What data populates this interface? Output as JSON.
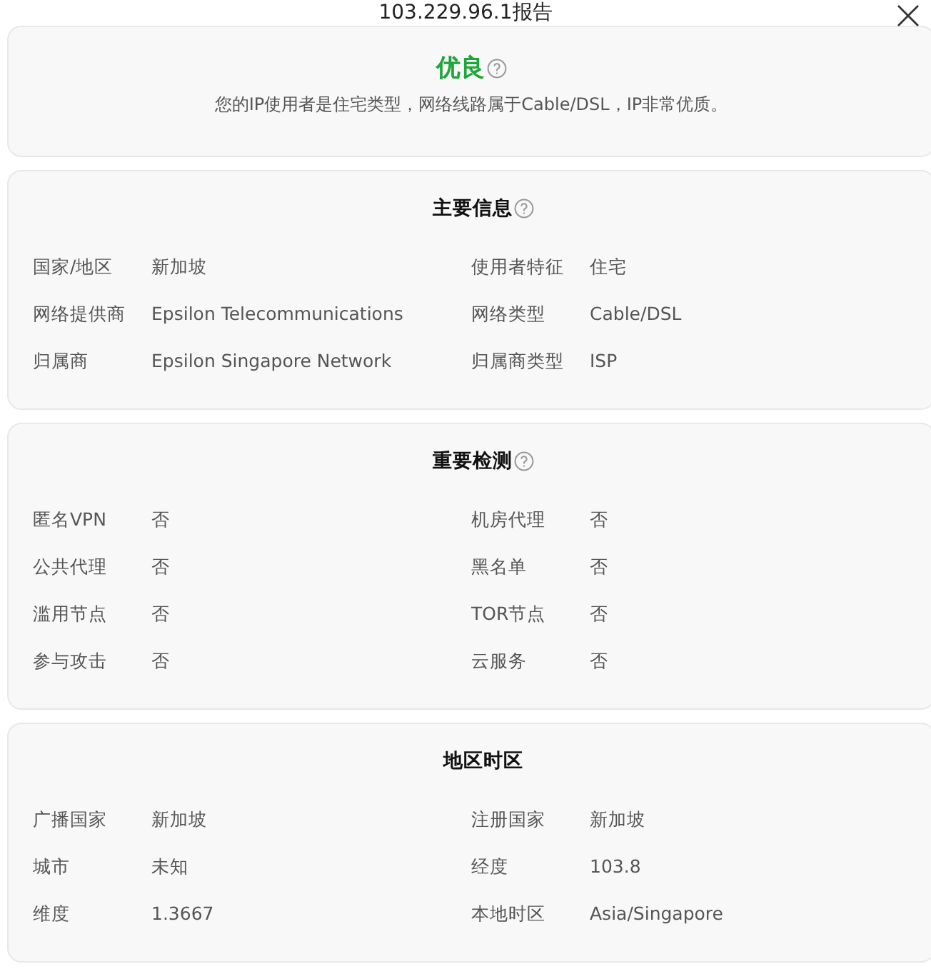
{
  "dialog": {
    "title": "103.229.96.1报告"
  },
  "summary": {
    "rating": "优良",
    "help": true,
    "description": "您的IP使用者是住宅类型，网络线路属于Cable/DSL，IP非常优质。"
  },
  "sections": [
    {
      "title": "主要信息",
      "help": true,
      "rows": [
        {
          "label": "国家/地区",
          "value": "新加坡"
        },
        {
          "label": "使用者特征",
          "value": "住宅"
        },
        {
          "label": "网络提供商",
          "value": "Epsilon Telecommunications"
        },
        {
          "label": "网络类型",
          "value": "Cable/DSL"
        },
        {
          "label": "归属商",
          "value": "Epsilon Singapore Network"
        },
        {
          "label": "归属商类型",
          "value": "ISP"
        }
      ]
    },
    {
      "title": "重要检测",
      "help": true,
      "rows": [
        {
          "label": "匿名VPN",
          "value": "否"
        },
        {
          "label": "机房代理",
          "value": "否"
        },
        {
          "label": "公共代理",
          "value": "否"
        },
        {
          "label": "黑名单",
          "value": "否"
        },
        {
          "label": "滥用节点",
          "value": "否"
        },
        {
          "label": "TOR节点",
          "value": "否"
        },
        {
          "label": "参与攻击",
          "value": "否"
        },
        {
          "label": "云服务",
          "value": "否"
        }
      ]
    },
    {
      "title": "地区时区",
      "help": false,
      "rows": [
        {
          "label": "广播国家",
          "value": "新加坡"
        },
        {
          "label": "注册国家",
          "value": "新加坡"
        },
        {
          "label": "城市",
          "value": "未知"
        },
        {
          "label": "经度",
          "value": "103.8"
        },
        {
          "label": "维度",
          "value": "1.3667"
        },
        {
          "label": "本地时区",
          "value": "Asia/Singapore"
        }
      ]
    }
  ]
}
